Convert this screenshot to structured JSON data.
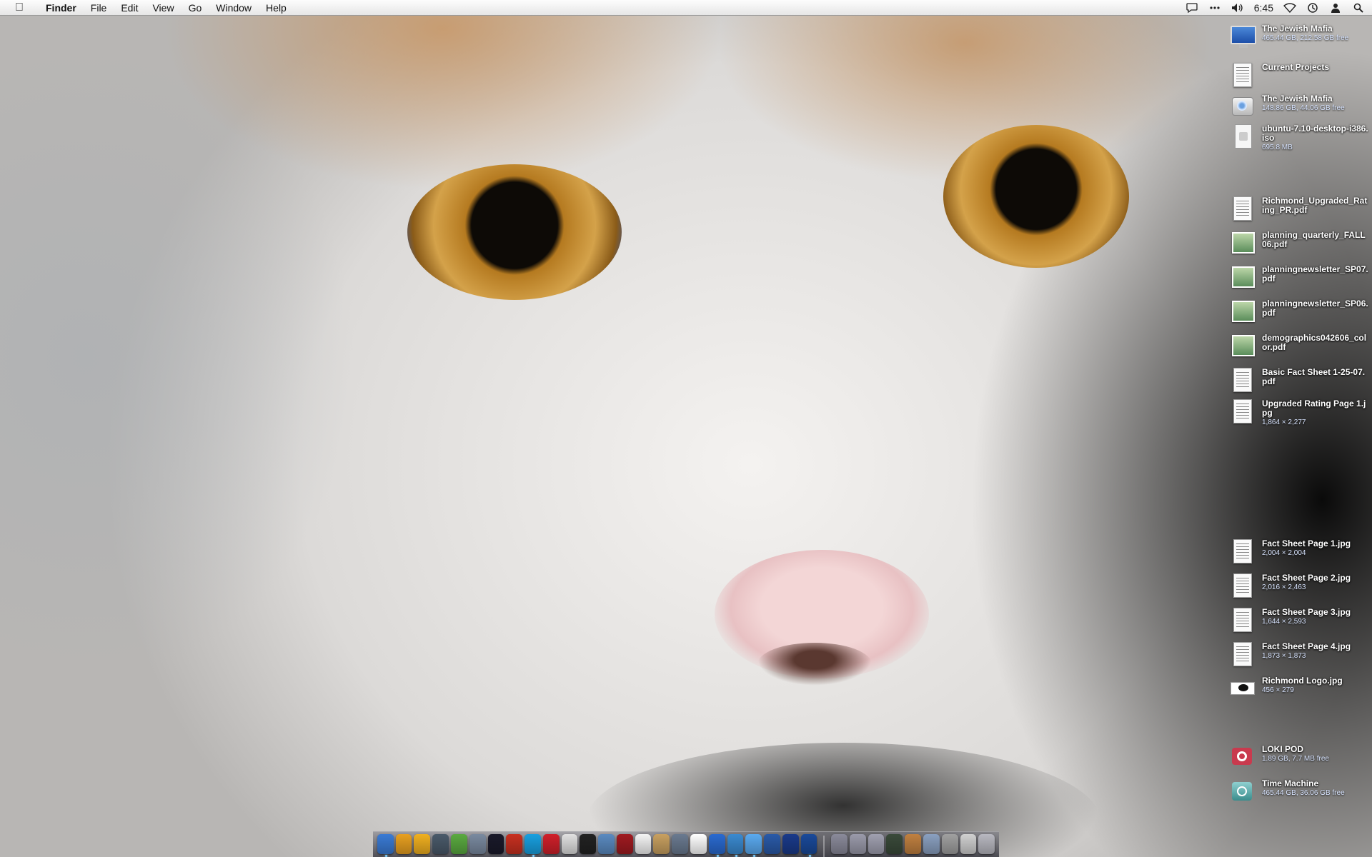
{
  "menubar": {
    "app_name": "Finder",
    "menus": [
      "File",
      "Edit",
      "View",
      "Go",
      "Window",
      "Help"
    ],
    "clock": "6:45"
  },
  "desktop_items": [
    {
      "name": "The Jewish Mafia",
      "info": "465.44 GB, 212.58 GB free",
      "icon": "monitor-drive-icon"
    },
    {
      "name": "Current Projects",
      "info": "",
      "icon": "folder-doc-icon"
    },
    {
      "name": "The Jewish Mafia",
      "info": "148.86 GB, 44.06 GB free",
      "icon": "disk-icon"
    },
    {
      "name": "ubuntu-7.10-desktop-i386.iso",
      "info": "695.8 MB",
      "icon": "iso-file-icon"
    },
    {
      "name": "Richmond_Upgraded_Rating_PR.pdf",
      "info": "",
      "icon": "pdf-file-icon"
    },
    {
      "name": "planning_quarterly_FALL06.pdf",
      "info": "",
      "icon": "pdf-file-icon"
    },
    {
      "name": "planningnewsletter_SP07.pdf",
      "info": "",
      "icon": "pdf-file-icon"
    },
    {
      "name": "planningnewsletter_SP06.pdf",
      "info": "",
      "icon": "pdf-file-icon"
    },
    {
      "name": "demographics042606_color.pdf",
      "info": "",
      "icon": "pdf-file-icon"
    },
    {
      "name": "Basic Fact Sheet 1-25-07.pdf",
      "info": "",
      "icon": "pdf-file-icon"
    },
    {
      "name": "Upgraded Rating Page 1.jpg",
      "info": "1,864 × 2,277",
      "icon": "jpg-file-icon"
    },
    {
      "name": "Fact Sheet Page 1.jpg",
      "info": "2,004 × 2,004",
      "icon": "jpg-file-icon"
    },
    {
      "name": "Fact Sheet Page 2.jpg",
      "info": "2,016 × 2,463",
      "icon": "jpg-file-icon"
    },
    {
      "name": "Fact Sheet Page 3.jpg",
      "info": "1,644 × 2,593",
      "icon": "jpg-file-icon"
    },
    {
      "name": "Fact Sheet Page 4.jpg",
      "info": "1,873 × 1,873",
      "icon": "jpg-file-icon"
    },
    {
      "name": "Richmond Logo.jpg",
      "info": "456 × 279",
      "icon": "logo-image-icon"
    },
    {
      "name": "LOKI POD",
      "info": "1.89 GB, 7.7 MB free",
      "icon": "ipod-icon"
    },
    {
      "name": "Time Machine",
      "info": "465.44 GB, 36.06 GB free",
      "icon": "time-machine-drive-icon"
    }
  ],
  "dock": {
    "icons": [
      {
        "name": "finder",
        "color": "#3a7bd5",
        "running": true
      },
      {
        "name": "money",
        "color": "#e8a020",
        "running": false
      },
      {
        "name": "infinity",
        "color": "#f0b020",
        "running": false
      },
      {
        "name": "spaces",
        "color": "#4a5a6a",
        "running": false
      },
      {
        "name": "leaf",
        "color": "#5aaa40",
        "running": false
      },
      {
        "name": "cube",
        "color": "#7a8aa0",
        "running": false
      },
      {
        "name": "dashboard",
        "color": "#1a1a2a",
        "running": false
      },
      {
        "name": "flash",
        "color": "#c83020",
        "running": false
      },
      {
        "name": "skype",
        "color": "#18a0e0",
        "running": true
      },
      {
        "name": "lastfm",
        "color": "#d0202a",
        "running": false
      },
      {
        "name": "itunes-old",
        "color": "#e0e0e0",
        "running": false
      },
      {
        "name": "terminal",
        "color": "#222222",
        "running": false
      },
      {
        "name": "preview",
        "color": "#5a8ac0",
        "running": false
      },
      {
        "name": "cherries",
        "color": "#a01a20",
        "running": false
      },
      {
        "name": "ical",
        "color": "#f4f4f4",
        "running": false
      },
      {
        "name": "address-book",
        "color": "#c8a060",
        "running": false
      },
      {
        "name": "ibook",
        "color": "#6a7a90",
        "running": false
      },
      {
        "name": "textedit",
        "color": "#ffffff",
        "running": false
      },
      {
        "name": "itunes",
        "color": "#2a6ad0",
        "running": true
      },
      {
        "name": "safari",
        "color": "#3a8ad0",
        "running": true
      },
      {
        "name": "ichat",
        "color": "#5aaaf0",
        "running": true
      },
      {
        "name": "word",
        "color": "#2a5aa8",
        "running": false
      },
      {
        "name": "pen",
        "color": "#1a3a8a",
        "running": false
      },
      {
        "name": "photoshop",
        "color": "#1a4a9a",
        "running": true
      },
      {
        "name": "applications-stack",
        "color": "#8a8a9a",
        "running": false
      },
      {
        "name": "documents-stack",
        "color": "#9a9aaa",
        "running": false
      },
      {
        "name": "downloads-stack",
        "color": "#a0a0b0",
        "running": false
      },
      {
        "name": "camera",
        "color": "#3a4a3a",
        "running": false
      },
      {
        "name": "box",
        "color": "#c08040",
        "running": false
      },
      {
        "name": "stack",
        "color": "#8aa0c0",
        "running": false
      },
      {
        "name": "tools",
        "color": "#a0a0a0",
        "running": false
      },
      {
        "name": "doc-stack",
        "color": "#d0d0d0",
        "running": false
      },
      {
        "name": "trash",
        "color": "#b8b8c0",
        "running": false
      }
    ]
  }
}
